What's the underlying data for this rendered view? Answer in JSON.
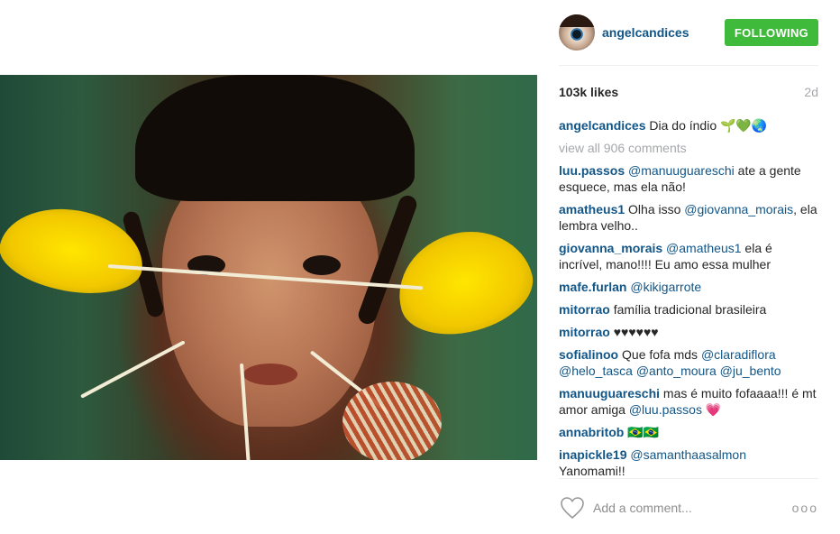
{
  "post": {
    "username": "angelcandices",
    "follow_label": "FOLLOWING",
    "likes": "103k likes",
    "age": "2d",
    "caption_user": "angelcandices",
    "caption_text": "Dia do índio 🌱💚🌏",
    "view_all": "view all 906 comments"
  },
  "comments": [
    {
      "user": "luu.passos",
      "mention": "@manuuguareschi",
      "text": " ate a gente esquece, mas ela não!"
    },
    {
      "user": "amatheus1",
      "text1": "Olha isso ",
      "mention": "@giovanna_morais",
      "text2": ", ela lembra velho.."
    },
    {
      "user": "giovanna_morais",
      "mention": "@amatheus1",
      "text": " ela é incrível, mano!!!! Eu amo essa mulher"
    },
    {
      "user": "mafe.furlan",
      "mention": "@kikigarrote"
    },
    {
      "user": "mitorrao",
      "text": "família tradicional brasileira"
    },
    {
      "user": "mitorrao",
      "text": "♥♥♥♥♥♥"
    },
    {
      "user": "sofialinoo",
      "text": "Que fofa mds ",
      "mentions": [
        "@claradiflora",
        "@helo_tasca",
        "@anto_moura",
        "@ju_bento"
      ]
    },
    {
      "user": "manuuguareschi",
      "text": "mas é muito fofaaaa!!! é mt amor amiga ",
      "mention": "@luu.passos",
      "text2": " 💗"
    },
    {
      "user": "annabritob",
      "text": "🇧🇷🇧🇷"
    },
    {
      "user": "inapickle19",
      "mention": "@samanthaasalmon",
      "text": "Yanomami!!"
    }
  ],
  "footer": {
    "add_comment_placeholder": "Add a comment...",
    "more_label": "ooo"
  },
  "colors": {
    "link": "#125688",
    "follow_button": "#3fba3b",
    "muted": "#a5a7aa"
  }
}
